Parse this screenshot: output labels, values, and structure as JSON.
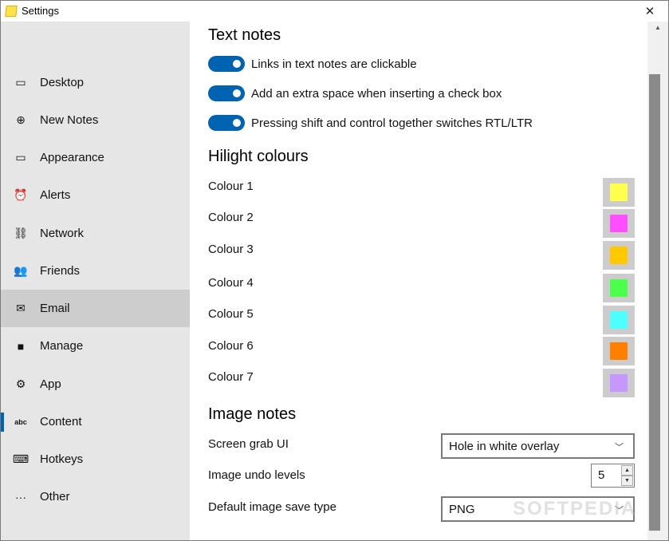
{
  "window": {
    "title": "Settings"
  },
  "sidebar": {
    "items": [
      {
        "label": "Desktop",
        "icon": "monitor-icon",
        "glyph": "▭"
      },
      {
        "label": "New Notes",
        "icon": "plus-circle-icon",
        "glyph": "⊕"
      },
      {
        "label": "Appearance",
        "icon": "appearance-icon",
        "glyph": "▭"
      },
      {
        "label": "Alerts",
        "icon": "alarm-clock-icon",
        "glyph": "⏰"
      },
      {
        "label": "Network",
        "icon": "network-icon",
        "glyph": "⛓"
      },
      {
        "label": "Friends",
        "icon": "people-icon",
        "glyph": "👥"
      },
      {
        "label": "Email",
        "icon": "mail-icon",
        "glyph": "✉"
      },
      {
        "label": "Manage",
        "icon": "folder-icon",
        "glyph": "■"
      },
      {
        "label": "App",
        "icon": "gear-icon",
        "glyph": "⚙"
      },
      {
        "label": "Content",
        "icon": "abc-icon",
        "glyph": "abc"
      },
      {
        "label": "Hotkeys",
        "icon": "keyboard-icon",
        "glyph": "⌨"
      },
      {
        "label": "Other",
        "icon": "more-icon",
        "glyph": "···"
      }
    ],
    "hovered_index": 6,
    "selected_index": 9,
    "accent_color": "#0063b1"
  },
  "text_notes": {
    "heading": "Text notes",
    "toggles": [
      {
        "label": "Links in text notes are clickable",
        "on": true
      },
      {
        "label": "Add an extra space when inserting a check box",
        "on": true
      },
      {
        "label": "Pressing shift and control together switches RTL/LTR",
        "on": true
      }
    ]
  },
  "hilight_colours": {
    "heading": "Hilight colours",
    "colours": [
      {
        "label": "Colour 1",
        "color": "#ffff4d"
      },
      {
        "label": "Colour 2",
        "color": "#ff4dff"
      },
      {
        "label": "Colour 3",
        "color": "#ffc800"
      },
      {
        "label": "Colour 4",
        "color": "#4dff4d"
      },
      {
        "label": "Colour 5",
        "color": "#4dffff"
      },
      {
        "label": "Colour 6",
        "color": "#ff8000"
      },
      {
        "label": "Colour 7",
        "color": "#c896ff"
      }
    ]
  },
  "image_notes": {
    "heading": "Image notes",
    "screen_grab": {
      "label": "Screen grab UI",
      "value": "Hole in white overlay"
    },
    "undo_levels": {
      "label": "Image undo levels",
      "value": "5"
    },
    "save_type": {
      "label": "Default image save type",
      "value": "PNG"
    }
  },
  "watermark": "SOFTPEDIA"
}
